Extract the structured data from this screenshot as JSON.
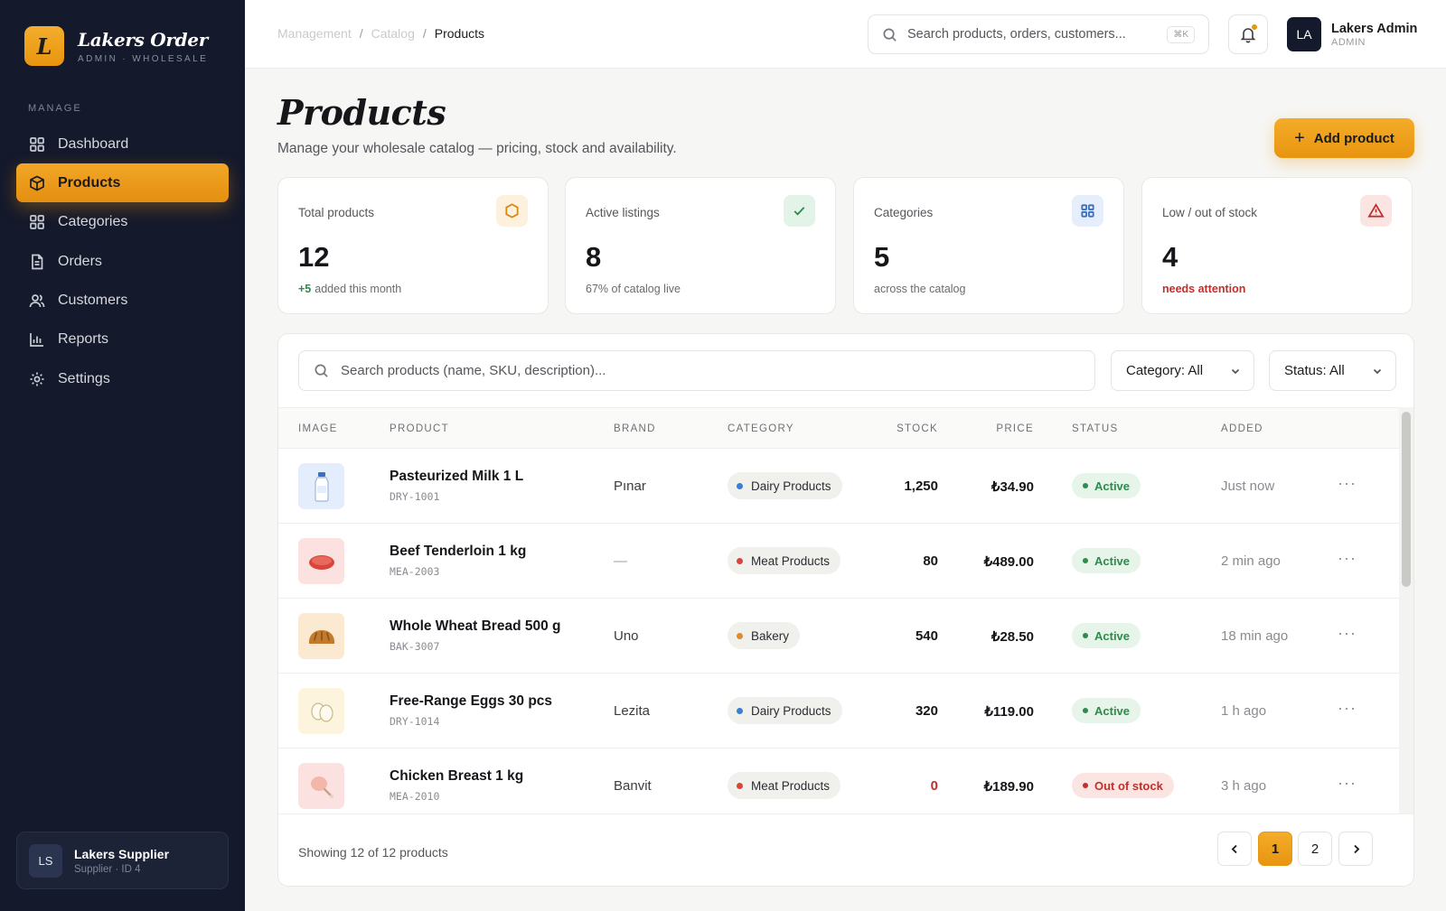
{
  "brand": {
    "logo_letter": "L",
    "name": "Lakers Order",
    "sub": "ADMIN · WHOLESALE"
  },
  "sidebar": {
    "section": "MANAGE",
    "items": [
      {
        "label": "Dashboard",
        "icon": "grid-icon"
      },
      {
        "label": "Products",
        "icon": "box-icon",
        "active": true
      },
      {
        "label": "Categories",
        "icon": "grid-icon"
      },
      {
        "label": "Orders",
        "icon": "document-icon"
      },
      {
        "label": "Customers",
        "icon": "users-icon"
      },
      {
        "label": "Reports",
        "icon": "bar-chart-icon"
      },
      {
        "label": "Settings",
        "icon": "gear-icon"
      }
    ],
    "user": {
      "initials": "LS",
      "name": "Lakers Supplier",
      "sub": "Supplier · ID 4"
    }
  },
  "topbar": {
    "breadcrumbs": [
      "Management",
      "Catalog",
      "Products"
    ],
    "search_placeholder": "Search products, orders, customers...",
    "shortcut": "⌘K",
    "admin": {
      "initials": "LA",
      "name": "Lakers Admin",
      "role": "ADMIN"
    }
  },
  "header": {
    "title": "Products",
    "subtitle": "Manage your wholesale catalog — pricing, stock and availability.",
    "add_button": "Add product"
  },
  "stats": [
    {
      "label": "Total products",
      "value": "12",
      "note_highlight": "+5",
      "note": "added this month",
      "icon": "box-icon"
    },
    {
      "label": "Active listings",
      "value": "8",
      "note": "67% of catalog live",
      "icon": "check-icon"
    },
    {
      "label": "Categories",
      "value": "5",
      "note": "across the catalog",
      "icon": "grid-icon"
    },
    {
      "label": "Low / out of stock",
      "value": "4",
      "note": "needs attention",
      "icon": "warning-icon"
    }
  ],
  "table": {
    "search_placeholder": "Search products (name, SKU, description)...",
    "filters": {
      "category": "Category: All",
      "status": "Status: All"
    },
    "columns": [
      "IMAGE",
      "PRODUCT",
      "BRAND",
      "CATEGORY",
      "STOCK",
      "PRICE",
      "STATUS",
      "ADDED"
    ],
    "rows": [
      {
        "name": "Pasteurized Milk 1 L",
        "sku": "DRY-1001",
        "brand": "Pınar",
        "category": "Dairy Products",
        "stock": "1,250",
        "price": "₺34.90",
        "status": "Active",
        "added": "Just now",
        "thumb": "milk-bottle-icon"
      },
      {
        "name": "Beef Tenderloin 1 kg",
        "sku": "MEA-2003",
        "brand": "—",
        "category": "Meat Products",
        "stock": "80",
        "price": "₺489.00",
        "status": "Active",
        "added": "2 min ago",
        "thumb": "steak-icon"
      },
      {
        "name": "Whole Wheat Bread 500 g",
        "sku": "BAK-3007",
        "brand": "Uno",
        "category": "Bakery",
        "stock": "540",
        "price": "₺28.50",
        "status": "Active",
        "added": "18 min ago",
        "thumb": "bread-icon"
      },
      {
        "name": "Free-Range Eggs 30 pcs",
        "sku": "DRY-1014",
        "brand": "Lezita",
        "category": "Dairy Products",
        "stock": "320",
        "price": "₺119.00",
        "status": "Active",
        "added": "1 h ago",
        "thumb": "eggs-icon"
      },
      {
        "name": "Chicken Breast 1 kg",
        "sku": "MEA-2010",
        "brand": "Banvit",
        "category": "Meat Products",
        "stock": "0",
        "price": "₺189.90",
        "status": "Out of stock",
        "added": "3 h ago",
        "thumb": "chicken-icon"
      }
    ],
    "footer": "Showing 12 of 12 products",
    "pages": [
      "1",
      "2"
    ]
  },
  "colors": {
    "accent": "#e8950f",
    "sidebar": "#14192b",
    "dairy": "#3b7dd8",
    "meat": "#d9453b",
    "bakery": "#e08a2c"
  }
}
